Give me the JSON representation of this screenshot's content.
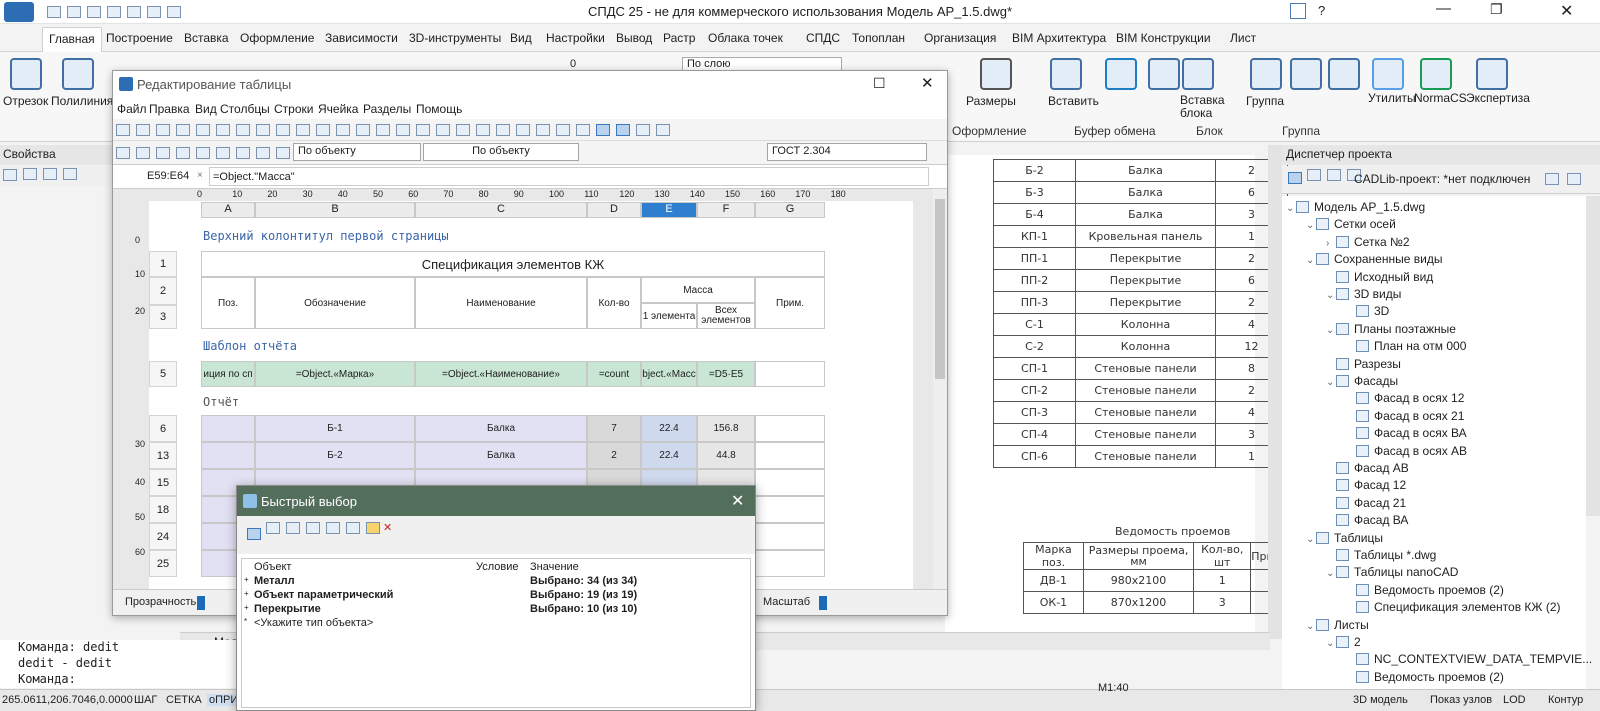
{
  "app": {
    "title": "СПДС 25 - не для коммерческого использования Модель АР_1.5.dwg*"
  },
  "ribbon": {
    "tabs": [
      "Главная",
      "Построение",
      "Вставка",
      "Оформление",
      "Зависимости",
      "3D-инструменты",
      "Вид",
      "Настройки",
      "Вывод",
      "Растр",
      "Облака точек",
      "СПДС",
      "Топоплан",
      "Организация",
      "BIM Архитектура",
      "BIM Конструкции",
      "Лист"
    ],
    "active_tab": "Главная",
    "tools": {
      "otrezok": "Отрезок",
      "polyline": "Полилиния",
      "layer_combo": "По слою",
      "sizes": "Размеры",
      "paste": "Вставить",
      "insert_block": "Вставка блока",
      "group": "Группа",
      "utilities": "Утилиты",
      "normacs": "NormaCS",
      "expertise": "Экспертиза",
      "zero": "0"
    },
    "groups": {
      "oformlenie": "Оформление",
      "buffer": "Буфер обмена",
      "block": "Блок",
      "group": "Группа"
    }
  },
  "properties": {
    "title": "Свойства"
  },
  "table_editor": {
    "title": "Редактирование таблицы",
    "menu": [
      "Файл",
      "Правка",
      "Вид",
      "Столбцы",
      "Строки",
      "Ячейка",
      "Разделы",
      "Помощь"
    ],
    "color_combo": "По объекту",
    "line_combo": "По объекту",
    "style_combo": "ГОСТ 2.304",
    "cell_ref": "E59:E64",
    "formula": "=Object.\"Масса\"",
    "ruler": [
      "0",
      "10",
      "20",
      "30",
      "40",
      "50",
      "60",
      "70",
      "80",
      "90",
      "100",
      "110",
      "120",
      "130",
      "140",
      "150",
      "160",
      "170",
      "180"
    ],
    "columns": [
      "A",
      "B",
      "C",
      "D",
      "E",
      "F",
      "G"
    ],
    "side_ruler": [
      "0",
      "10",
      "20",
      "30",
      "40",
      "50",
      "60"
    ],
    "header_title": "Верхний колонтитул первой страницы",
    "spec_title": "Спецификация элементов КЖ",
    "head": {
      "pos": "Поз.",
      "designation": "Обозначение",
      "name": "Наименование",
      "qty": "Кол-во",
      "mass": "Масса",
      "mass1": "1 элемента",
      "mass_all": "Всех элементов",
      "note": "Прим."
    },
    "template_title": "Шаблон отчёта",
    "template_row": [
      "иция по сп",
      "=Object.«Марка»",
      "=Object.«Наименование»",
      "=count",
      "bject.«Масс",
      "=D5·E5"
    ],
    "report_title": "Отчёт",
    "rows": [
      {
        "n": "6",
        "mark": "Б-1",
        "name": "Балка",
        "qty": "7",
        "m1": "22.4",
        "mall": "156.8"
      },
      {
        "n": "13",
        "mark": "Б-2",
        "name": "Балка",
        "qty": "2",
        "m1": "22.4",
        "mall": "44.8"
      },
      {
        "n": "15"
      },
      {
        "n": "18"
      },
      {
        "n": "24"
      },
      {
        "n": "25"
      }
    ],
    "row_numbers": [
      "1",
      "2",
      "3",
      "5"
    ],
    "transparency": "Прозрачность",
    "scale": "Масштаб"
  },
  "quick_select": {
    "title": "Быстрый выбор",
    "cols": {
      "object": "Объект",
      "condition": "Условие",
      "value": "Значение"
    },
    "rows": [
      {
        "object": "Металл",
        "value": "Выбрано: 34 (из 34)"
      },
      {
        "object": "Объект параметрический",
        "value": "Выбрано: 19 (из 19)"
      },
      {
        "object": "Перекрытие",
        "value": "Выбрано: 10 (из 10)"
      },
      {
        "object": "<Укажите тип объекта>",
        "value": ""
      }
    ]
  },
  "drawing": {
    "rows": [
      [
        "Б-2",
        "Балка",
        "2"
      ],
      [
        "Б-3",
        "Балка",
        "6"
      ],
      [
        "Б-4",
        "Балка",
        "3"
      ],
      [
        "КП-1",
        "Кровельная панель",
        "1"
      ],
      [
        "ПП-1",
        "Перекрытие",
        "2"
      ],
      [
        "ПП-2",
        "Перекрытие",
        "6"
      ],
      [
        "ПП-3",
        "Перекрытие",
        "2"
      ],
      [
        "С-1",
        "Колонна",
        "4"
      ],
      [
        "С-2",
        "Колонна",
        "12"
      ],
      [
        "СП-1",
        "Стеновые панели",
        "8"
      ],
      [
        "СП-2",
        "Стеновые панели",
        "2"
      ],
      [
        "СП-3",
        "Стеновые панели",
        "4"
      ],
      [
        "СП-4",
        "Стеновые панели",
        "3"
      ],
      [
        "СП-6",
        "Стеновые панели",
        "1"
      ]
    ],
    "openings_title": "Ведомость проемов",
    "openings_head": [
      "Марка поз.",
      "Размеры проема, мм",
      "Кол-во, шт",
      "Прим"
    ],
    "openings": [
      [
        "ДВ-1",
        "980х2100",
        "1"
      ],
      [
        "ОК-1",
        "870х1200",
        "3"
      ]
    ]
  },
  "project_manager": {
    "title": "Диспетчер проекта",
    "cadlib": "CADLib-проект: *нет подключен",
    "tree": [
      {
        "t": "Модель АР_1.5.dwg",
        "l": 0,
        "e": "⌄"
      },
      {
        "t": "Сетки осей",
        "l": 1,
        "e": "⌄"
      },
      {
        "t": "Сетка №2",
        "l": 2,
        "e": "›"
      },
      {
        "t": "Сохраненные виды",
        "l": 1,
        "e": "⌄"
      },
      {
        "t": "Исходный вид",
        "l": 2,
        "e": ""
      },
      {
        "t": "3D виды",
        "l": 2,
        "e": "⌄"
      },
      {
        "t": "3D",
        "l": 3,
        "e": ""
      },
      {
        "t": "Планы поэтажные",
        "l": 2,
        "e": "⌄"
      },
      {
        "t": "План на отм 000",
        "l": 3,
        "e": ""
      },
      {
        "t": "Разрезы",
        "l": 2,
        "e": ""
      },
      {
        "t": "Фасады",
        "l": 2,
        "e": "⌄"
      },
      {
        "t": "Фасад в осях 12",
        "l": 3,
        "e": ""
      },
      {
        "t": "Фасад в осях 21",
        "l": 3,
        "e": ""
      },
      {
        "t": "Фасад в осях ВА",
        "l": 3,
        "e": ""
      },
      {
        "t": "Фасад в осях АВ",
        "l": 3,
        "e": ""
      },
      {
        "t": "Фасад АВ",
        "l": 2,
        "e": ""
      },
      {
        "t": "Фасад 12",
        "l": 2,
        "e": ""
      },
      {
        "t": "Фасад 21",
        "l": 2,
        "e": ""
      },
      {
        "t": "Фасад ВА",
        "l": 2,
        "e": ""
      },
      {
        "t": "Таблицы",
        "l": 1,
        "e": "⌄"
      },
      {
        "t": "Таблицы *.dwg",
        "l": 2,
        "e": ""
      },
      {
        "t": "Таблицы nanoCAD",
        "l": 2,
        "e": "⌄"
      },
      {
        "t": "Ведомость проемов (2)",
        "l": 3,
        "e": ""
      },
      {
        "t": "Спецификация элементов КЖ (2)",
        "l": 3,
        "e": ""
      },
      {
        "t": "Листы",
        "l": 1,
        "e": "⌄"
      },
      {
        "t": "2",
        "l": 2,
        "e": "⌄"
      },
      {
        "t": "NC_CONTEXTVIEW_DATA_TEMPVIE...",
        "l": 3,
        "e": ""
      },
      {
        "t": "Ведомость проемов (2)",
        "l": 3,
        "e": ""
      }
    ]
  },
  "command": {
    "lines": [
      "Команда: dedit",
      "dedit - dedit",
      "Команда:"
    ]
  },
  "statusbar": {
    "coords": "265.0611,206.7046,0.0000",
    "step": "ШАГ",
    "grid": "СЕТКА",
    "ortho": "оПРИ",
    "scale": "M1:40",
    "model3d": "3D модель",
    "show_nodes": "Показ узлов",
    "lod": "LOD",
    "contour": "Контур"
  },
  "model_tab": "Мод"
}
